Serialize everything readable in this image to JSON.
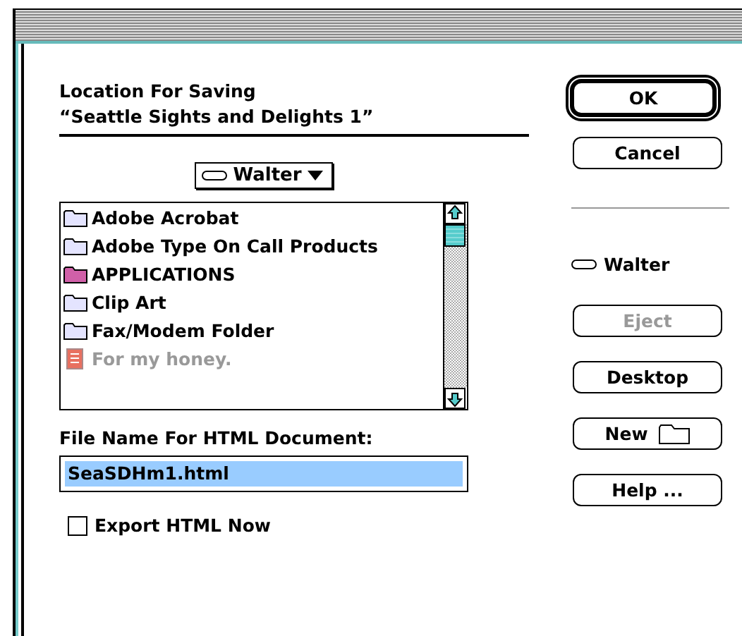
{
  "heading": {
    "lines": [
      "Location For Saving",
      "“Seattle Sights and Delights 1”"
    ]
  },
  "popup": {
    "label": "Walter"
  },
  "files": [
    {
      "name": "Adobe Acrobat",
      "kind": "folder",
      "color": "#e4e4ff",
      "disabled": false
    },
    {
      "name": "Adobe Type On Call Products",
      "kind": "folder",
      "color": "#e4e4ff",
      "disabled": false
    },
    {
      "name": "APPLICATIONS",
      "kind": "folder",
      "color": "#d060a8",
      "disabled": false
    },
    {
      "name": "Clip Art",
      "kind": "folder",
      "color": "#e4e4ff",
      "disabled": false
    },
    {
      "name": "Fax/Modem Folder",
      "kind": "folder",
      "color": "#e4e4ff",
      "disabled": false
    },
    {
      "name": "For my honey.",
      "kind": "document",
      "color": "#e87060",
      "disabled": true
    }
  ],
  "filename": {
    "label": "File Name For HTML Document:",
    "value": "SeaSDHm1.html",
    "selected": true
  },
  "export": {
    "label": "Export HTML Now",
    "checked": false
  },
  "drive": {
    "label": "Walter"
  },
  "top_buttons": [
    {
      "label": "OK",
      "default": true,
      "disabled": false
    },
    {
      "label": "Cancel",
      "default": false,
      "disabled": false
    }
  ],
  "side_buttons": [
    {
      "label": "Eject",
      "default": false,
      "disabled": true,
      "kind": "text"
    },
    {
      "label": "Desktop",
      "default": false,
      "disabled": false,
      "kind": "text"
    },
    {
      "label": "New",
      "default": false,
      "disabled": false,
      "kind": "new-folder"
    },
    {
      "label": "Help ...",
      "default": false,
      "disabled": false,
      "kind": "text"
    }
  ]
}
